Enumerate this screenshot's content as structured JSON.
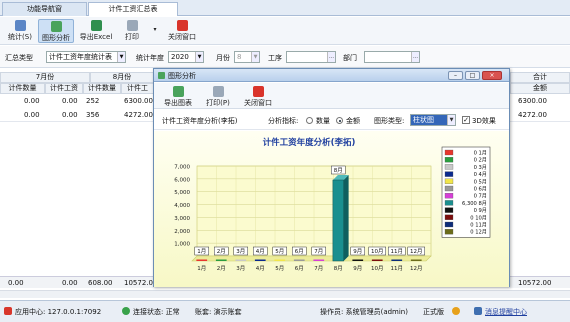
{
  "tabs": [
    "功能导航窗",
    "计件工资汇总表"
  ],
  "toolbar": {
    "stats": "统计(S)",
    "graph": "图形分析",
    "export": "导出Excel",
    "print": "打印",
    "close": "关闭窗口"
  },
  "filters": {
    "summary_type_label": "汇总类型",
    "summary_type_value": "计件工资年度统计表",
    "year_label": "统计年度",
    "year_value": "2020",
    "month_label": "月份",
    "month_value": "8",
    "process_label": "工序",
    "process_value": "",
    "dept_label": "部门",
    "dept_value": ""
  },
  "grid": {
    "group_july": "7月份",
    "group_aug": "8月份",
    "group_total": "合计",
    "cols": [
      "计件数量",
      "计件工资",
      "计件数量",
      "计件工"
    ],
    "total_col": "金额",
    "rows": [
      [
        "0.00",
        "0.00",
        "252",
        "6300.00",
        "6300.00"
      ],
      [
        "0.00",
        "0.00",
        "356",
        "4272.00",
        "4272.00"
      ]
    ],
    "sum_cells": [
      "0.00",
      "0.00",
      "608.00",
      "10572.00",
      "10572.00"
    ]
  },
  "status": {
    "app_center": "应用中心: 127.0.0.1:7092",
    "conn": "连接状态: 正常",
    "account": "账套: 演示账套",
    "operator": "操作员: 系统管理员(admin)",
    "version": "正式版",
    "notice": "消息提醒中心"
  },
  "dialog": {
    "title": "图形分析",
    "export_btn": "导出图表",
    "print_btn": "打印(P)",
    "close_btn": "关闭窗口",
    "analysis_label": "计件工资年度分析(李拓)",
    "metric_label": "分析指标:",
    "metric_qty": "数量",
    "metric_amt": "金额",
    "chart_type_label": "图形类型:",
    "chart_type_value": "柱状图",
    "effect_3d": "3D效果"
  },
  "chart_data": {
    "type": "bar",
    "title": "计件工资年度分析(李拓)",
    "categories": [
      "1月",
      "2月",
      "3月",
      "4月",
      "5月",
      "6月",
      "7月",
      "8月",
      "9月",
      "10月",
      "11月",
      "12月"
    ],
    "values": [
      0,
      0,
      0,
      0,
      0,
      0,
      0,
      6300,
      0,
      0,
      0,
      0
    ],
    "data_labels": [
      "1月",
      "2月",
      "3月",
      "4月",
      "5月",
      "6月",
      "7月",
      "8月",
      "9月",
      "10月",
      "11月",
      "12月"
    ],
    "legend": [
      "0 1月",
      "0 2月",
      "0 3月",
      "0 4月",
      "0 5月",
      "0 6月",
      "0 7月",
      "6,300 8月",
      "0 9月",
      "0 10月",
      "0 11月",
      "0 12月"
    ],
    "legend_colors": [
      "#e8352d",
      "#2a9d3f",
      "#c8c8c8",
      "#0b2a8e",
      "#f2e64a",
      "#999999",
      "#d63fd6",
      "#1a8f8f",
      "#111111",
      "#7a0d0d",
      "#0d2d7a",
      "#6b6b1a"
    ],
    "ylim": [
      0,
      7000
    ],
    "yticks": [
      "1,000",
      "2,000",
      "3,000",
      "4,000",
      "5,000",
      "6,000",
      "7,000"
    ],
    "grid": true,
    "legend_position": "right"
  },
  "colors": {
    "accent": "#3f6fb0",
    "title_text": "#1f3f9f",
    "active_bar": "#1a8f8f"
  }
}
